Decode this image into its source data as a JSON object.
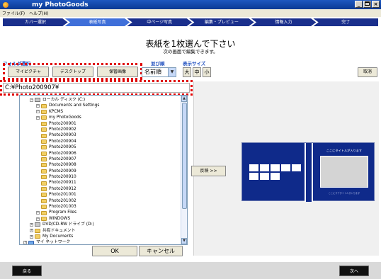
{
  "window": {
    "title": "my PhotoGoods",
    "controls": [
      "_",
      " ",
      "×"
    ]
  },
  "menu": [
    "ファイル(F)",
    "ヘルプ(H)"
  ],
  "steps": [
    "カバー選択",
    "表紙写真",
    "中ページ写真",
    "編集・プレビュー",
    "情報入力",
    "完了"
  ],
  "header": {
    "main": "表紙を1枚選んで下さい",
    "sub": "次の画面で編集できます。"
  },
  "folder_select": {
    "label": "フォルダ選択",
    "buttons": [
      "マイピクチャ",
      "デスクトップ",
      "保管画像"
    ]
  },
  "sort": {
    "label": "並び順",
    "value": "名前順"
  },
  "display_size": {
    "label": "表示サイズ",
    "options": [
      "大",
      "中",
      "小"
    ]
  },
  "cancel_top": "取消",
  "path": "C:¥Photo200907¥",
  "tree": [
    {
      "indent": 0,
      "exp": "⊟",
      "icon": "drive",
      "label": "ローカル ディスク (C:)"
    },
    {
      "indent": 1,
      "exp": "⊞",
      "icon": "folder",
      "label": "Documents and Settings"
    },
    {
      "indent": 1,
      "exp": "⊞",
      "icon": "folder",
      "label": "KPCMS"
    },
    {
      "indent": 1,
      "exp": "⊞",
      "icon": "folder",
      "label": "my PhotoGoods"
    },
    {
      "indent": 1,
      "exp": "",
      "icon": "folder",
      "label": "Photo200901"
    },
    {
      "indent": 1,
      "exp": "",
      "icon": "folder",
      "label": "Photo200902"
    },
    {
      "indent": 1,
      "exp": "",
      "icon": "folder",
      "label": "Photo200903"
    },
    {
      "indent": 1,
      "exp": "",
      "icon": "folder",
      "label": "Photo200904"
    },
    {
      "indent": 1,
      "exp": "",
      "icon": "folder",
      "label": "Photo200905"
    },
    {
      "indent": 1,
      "exp": "",
      "icon": "folder",
      "label": "Photo200906"
    },
    {
      "indent": 1,
      "exp": "",
      "icon": "folder",
      "label": "Photo200907"
    },
    {
      "indent": 1,
      "exp": "",
      "icon": "folder",
      "label": "Photo200908"
    },
    {
      "indent": 1,
      "exp": "",
      "icon": "folder",
      "label": "Photo200909"
    },
    {
      "indent": 1,
      "exp": "",
      "icon": "folder",
      "label": "Photo200910"
    },
    {
      "indent": 1,
      "exp": "",
      "icon": "folder",
      "label": "Photo200911"
    },
    {
      "indent": 1,
      "exp": "",
      "icon": "folder",
      "label": "Photo200912"
    },
    {
      "indent": 1,
      "exp": "",
      "icon": "folder",
      "label": "Photo201001"
    },
    {
      "indent": 1,
      "exp": "",
      "icon": "folder",
      "label": "Photo201002"
    },
    {
      "indent": 1,
      "exp": "",
      "icon": "folder",
      "label": "Photo201003"
    },
    {
      "indent": 1,
      "exp": "⊞",
      "icon": "folder",
      "label": "Program Files"
    },
    {
      "indent": 1,
      "exp": "⊞",
      "icon": "folder",
      "label": "WINDOWS"
    },
    {
      "indent": 0,
      "exp": "⊞",
      "icon": "drive",
      "label": "DVD/CD-RW ドライブ (D:)"
    },
    {
      "indent": 0,
      "exp": "⊞",
      "icon": "folder",
      "label": "共有ドキュメント"
    },
    {
      "indent": 0,
      "exp": "⊞",
      "icon": "folder",
      "label": "My Documents"
    },
    {
      "indent": -1,
      "exp": "⊞",
      "icon": "net",
      "label": "マイ ネットワーク"
    }
  ],
  "ok_label": "OK",
  "cancel_label": "キャンセル",
  "thumb_button": "反映 >>",
  "cover_preview": {
    "title": "ここにタイトルが入ります",
    "subtitle": "ここにサブタイトルが入ります"
  },
  "back_label": "戻る",
  "next_label": "次へ",
  "colors": {
    "accent": "#1f4fbf",
    "step_dark": "#1a2f8c",
    "step_active": "#3f6fd9",
    "highlight_dash": "#e00000",
    "cover_navy": "#0f2a8a"
  }
}
